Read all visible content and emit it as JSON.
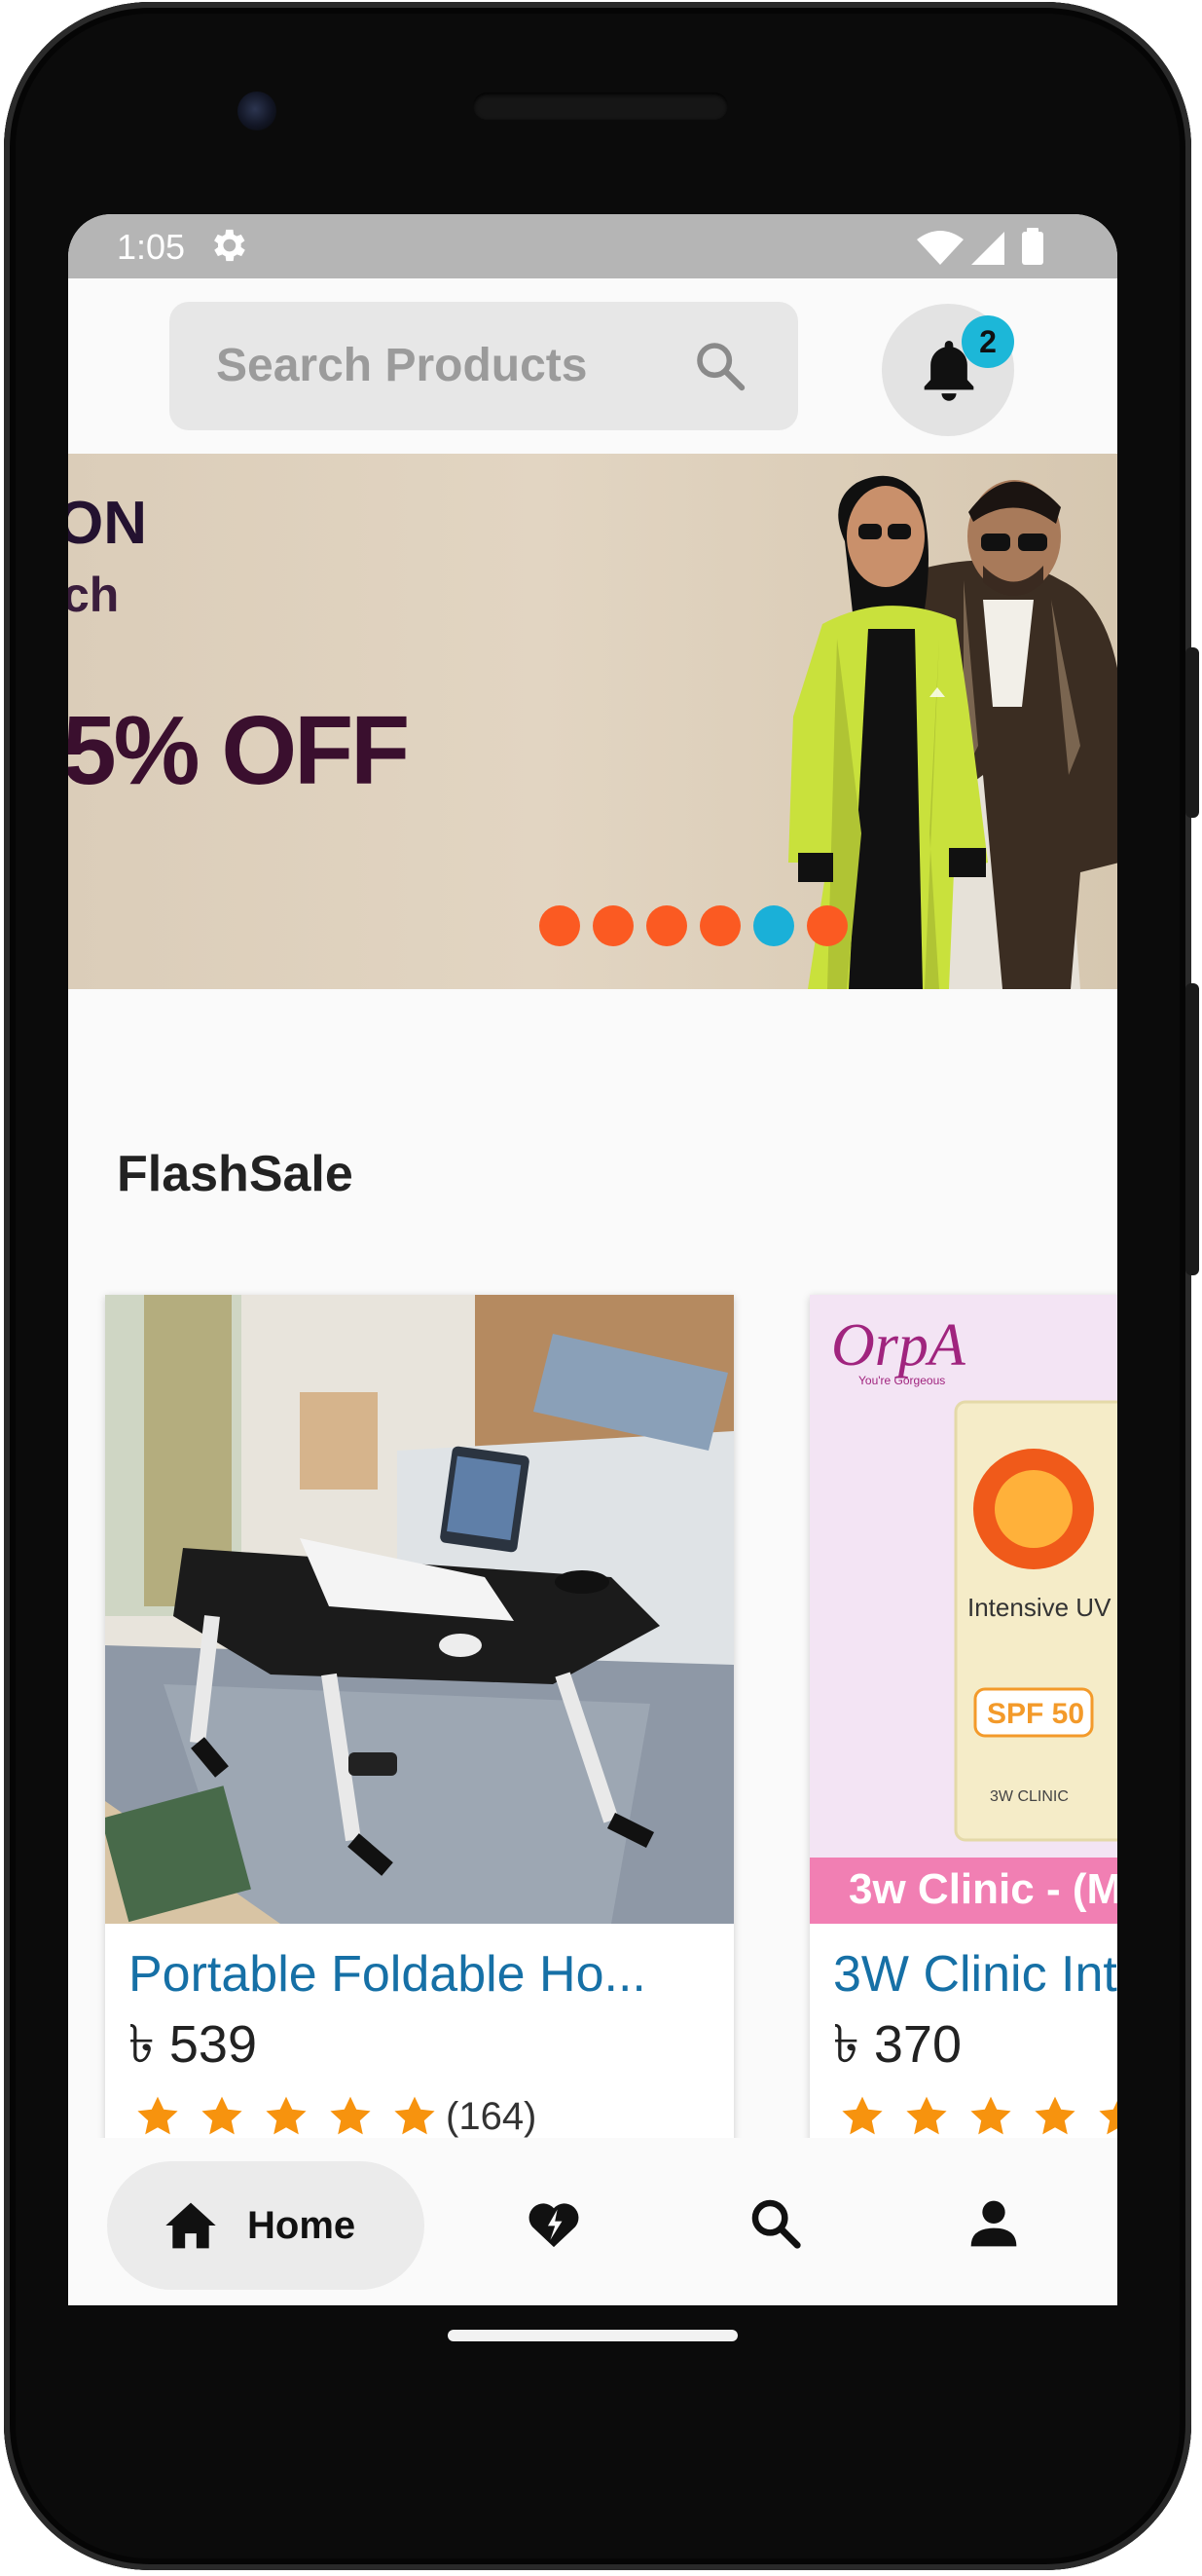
{
  "status_bar": {
    "time": "1:05",
    "icons": [
      "settings-icon",
      "wifi-icon",
      "signal-icon",
      "battery-icon"
    ]
  },
  "header": {
    "search_placeholder": "Search Products",
    "notification_count": "2"
  },
  "banner": {
    "text_line1": "ON",
    "text_line2": "ch",
    "text_line3": "5% OFF",
    "slide_count": 6,
    "active_slide_index": 4,
    "dot_color": "#fb5a22",
    "active_dot_color": "#1ab0d8"
  },
  "flash_sale": {
    "title": "FlashSale",
    "products": [
      {
        "title": "Portable Foldable Ho...",
        "price": "৳ 539",
        "rating": 5,
        "review_count": "(164)",
        "image": "laptop-table-photo"
      },
      {
        "title": "3W Clinic Int",
        "price": "৳ 370",
        "rating": 5,
        "image": "sunblock-cream-photo",
        "image_brand": "OrpA",
        "image_tagline": "You're Gorgeous",
        "image_product_name": "Intensive UV Sunblock Cream",
        "image_spf": "SPF 50",
        "image_maker": "3W CLINIC",
        "image_strip_text": "3w Clinic - (M"
      }
    ]
  },
  "bottom_nav": {
    "items": [
      {
        "label": "Home",
        "icon": "home-icon",
        "active": true
      },
      {
        "label": "",
        "icon": "flash-heart-icon",
        "active": false
      },
      {
        "label": "",
        "icon": "search-icon",
        "active": false
      },
      {
        "label": "",
        "icon": "profile-icon",
        "active": false
      }
    ]
  },
  "colors": {
    "accent_link": "#1670a6",
    "star": "#f7930e",
    "badge": "#1cb7d8",
    "status_bar": "#b5b5b5"
  }
}
